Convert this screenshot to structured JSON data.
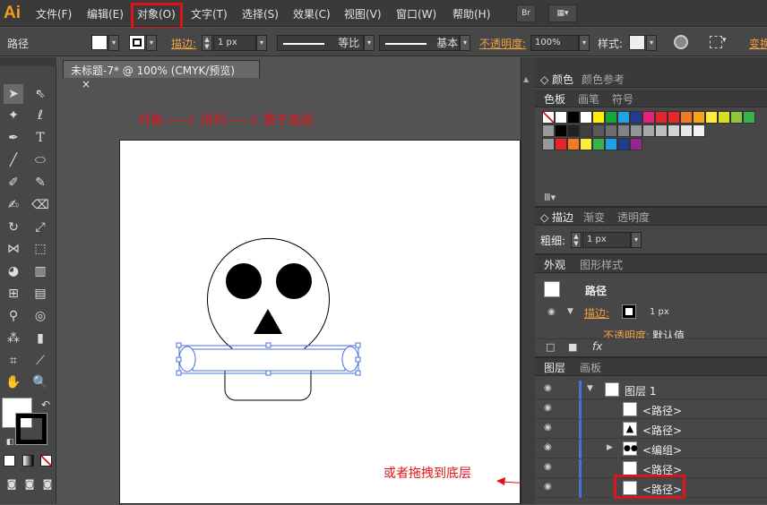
{
  "app": {
    "logo": "Ai"
  },
  "menu": [
    "文件(F)",
    "编辑(E)",
    "对象(O)",
    "文字(T)",
    "选择(S)",
    "效果(C)",
    "视图(V)",
    "窗口(W)",
    "帮助(H)"
  ],
  "menu_icons": [
    "bridge-icon",
    "arrange-documents-icon"
  ],
  "control_bar": {
    "object_type": "路径",
    "stroke_label": "描边:",
    "stroke_value": "1 px",
    "profile_label": "等比",
    "brush_label": "基本",
    "opacity_label": "不透明度:",
    "opacity_value": "100%",
    "style_label": "样式:",
    "transform_label": "变换"
  },
  "document": {
    "tab_title": "未标题-7* @ 100% (CMYK/预览)",
    "close": "×"
  },
  "annotations": {
    "top": "对象——》排列——》置于底层",
    "bottom": "或者拖拽到底层"
  },
  "swatches_panel": {
    "tabs": [
      "颜色",
      "颜色参考"
    ],
    "subtabs": [
      "色板",
      "画笔",
      "符号"
    ],
    "row1": [
      "#000000",
      "#ffffff",
      "#ffef00",
      "#14a83b",
      "#1fa1e4",
      "#213b8f",
      "#e8217b",
      "#e8262a",
      "#e8262a",
      "#f27b21",
      "#f9a31b",
      "#fced3c",
      "#d6e021",
      "#8dc63f",
      "#37b34a"
    ],
    "row2": [
      "#000000",
      "#231f20",
      "#414042",
      "#58595b",
      "#6d6e71",
      "#808285",
      "#939598",
      "#a7a9ac",
      "#bcbec0",
      "#d1d3d4",
      "#e6e7e8",
      "#f1f2f2"
    ],
    "row3": [
      "#e8262a",
      "#f27b21",
      "#fced3c",
      "#37b34a",
      "#1fa1e4",
      "#213b8f",
      "#92278f"
    ]
  },
  "stroke_panel": {
    "tabs": [
      "描边",
      "渐变",
      "透明度"
    ],
    "weight_label": "粗细:",
    "weight_value": "1 px"
  },
  "appearance_panel": {
    "tabs": [
      "外观",
      "图形样式"
    ],
    "title": "路径",
    "stroke_label": "描边:",
    "stroke_value": "1 px",
    "opacity_label": "不透明度:",
    "opacity_value": "默认值",
    "fx": "fx"
  },
  "layers_panel": {
    "tabs": [
      "图层",
      "画板"
    ],
    "layer_name": "图层 1",
    "rows": [
      "<路径>",
      "<路径>",
      "<编组>",
      "<路径>",
      "<路径>"
    ]
  },
  "colors": {
    "highlight": "#e0121a",
    "selection": "#4a6fdf",
    "accent": "#f59b22"
  }
}
